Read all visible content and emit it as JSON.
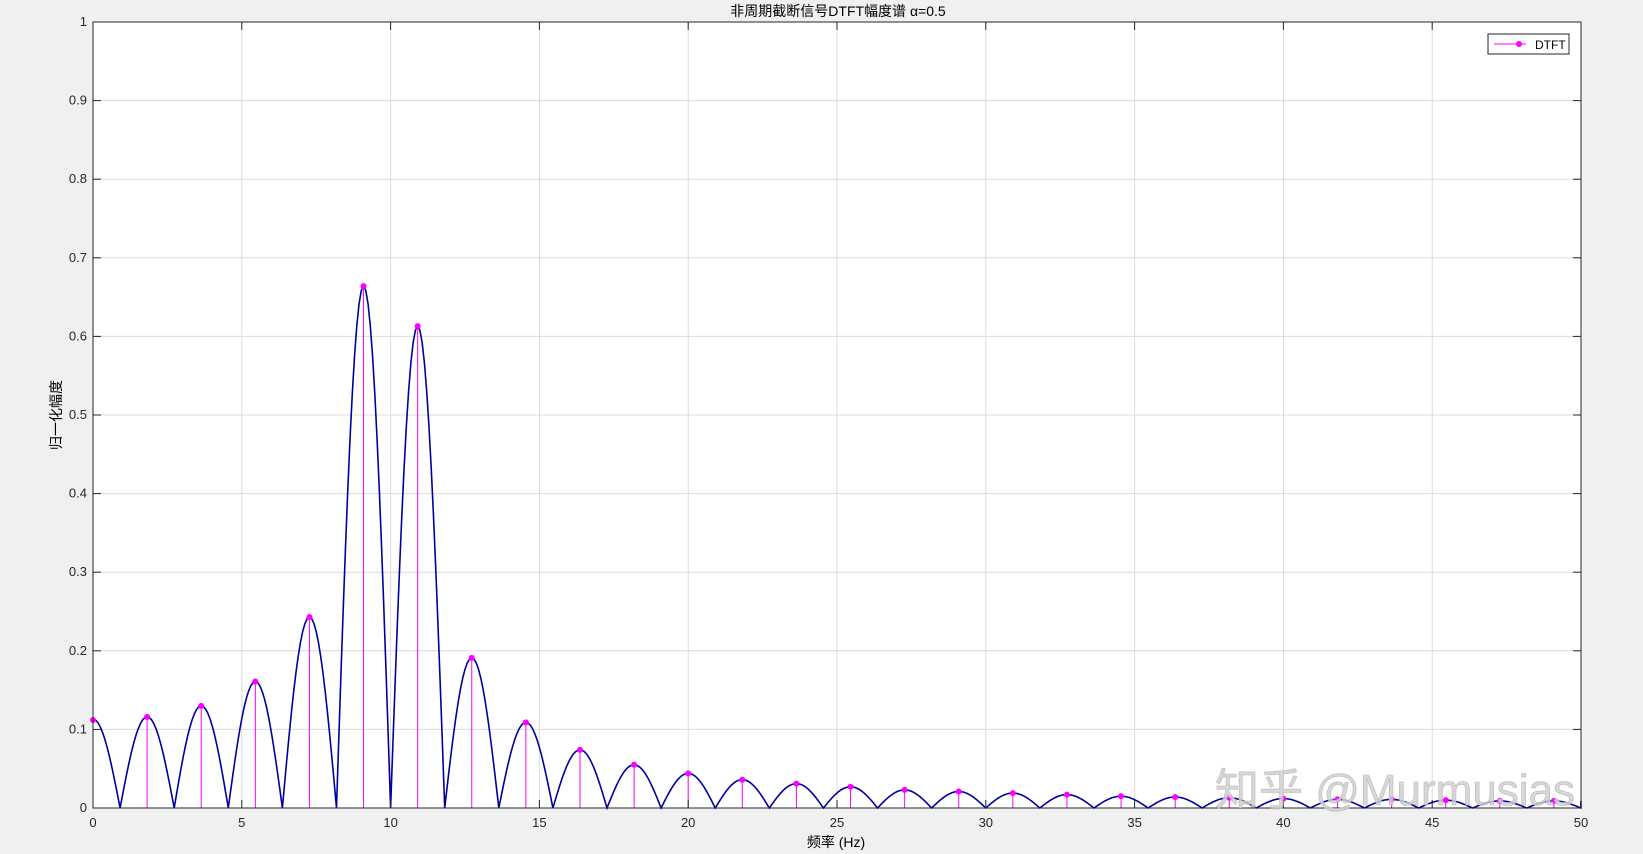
{
  "chart_data": {
    "type": "line",
    "title": "非周期截断信号DTFT幅度谱 α=0.5",
    "xlabel": "频率 (Hz)",
    "ylabel": "归一化幅度",
    "xlim": [
      0,
      50
    ],
    "ylim": [
      0,
      1
    ],
    "xticks": [
      0,
      5,
      10,
      15,
      20,
      25,
      30,
      35,
      40,
      45,
      50
    ],
    "yticks": [
      0,
      0.1,
      0.2,
      0.3,
      0.4,
      0.5,
      0.6,
      0.7,
      0.8,
      0.9,
      1
    ],
    "ytick_labels": [
      "0",
      "0.1",
      "0.2",
      "0.3",
      "0.4",
      "0.5",
      "0.6",
      "0.7",
      "0.8",
      "0.9",
      "1"
    ],
    "grid": true,
    "legend_position": "top-right",
    "series": [
      {
        "kind": "stem",
        "name": "DTFT",
        "color": "#ff00ff",
        "x": [
          0,
          1.818,
          3.636,
          5.455,
          7.273,
          9.091,
          10.909,
          12.727,
          14.545,
          16.364,
          18.182,
          20,
          21.818,
          23.636,
          25.455,
          27.273,
          29.091,
          30.909,
          32.727,
          34.545,
          36.364,
          38.182,
          40,
          41.818,
          43.636,
          45.455,
          47.273,
          49.091
        ],
        "y": [
          0.112,
          0.116,
          0.13,
          0.161,
          0.243,
          0.664,
          0.613,
          0.191,
          0.109,
          0.074,
          0.055,
          0.044,
          0.036,
          0.031,
          0.027,
          0.023,
          0.021,
          0.019,
          0.017,
          0.015,
          0.014,
          0.013,
          0.012,
          0.011,
          0.011,
          0.01,
          0.009,
          0.009
        ]
      },
      {
        "kind": "line",
        "color": "#0000a0",
        "main_lobe_center_hz": 10,
        "null_spacing_hz": 1.818,
        "first_null_hz": 0.91
      }
    ]
  },
  "watermark": "知乎 @Murmusias"
}
